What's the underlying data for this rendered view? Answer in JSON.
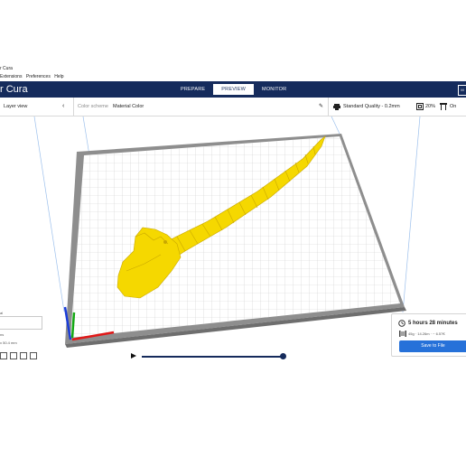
{
  "window": {
    "title": "r Cura"
  },
  "menu": {
    "items": [
      " Extensions",
      "Preferences",
      "Help"
    ]
  },
  "header": {
    "brand": "r Cura",
    "tabs": [
      {
        "label": "PREPARE",
        "active": false
      },
      {
        "label": "PREVIEW",
        "active": true
      },
      {
        "label": "MONITOR",
        "active": false
      }
    ],
    "right_button": "M"
  },
  "stage_bar": {
    "view_mode": "Layer view",
    "color_scheme_label": "Color scheme",
    "color_scheme_value": "Material Color",
    "quality": "Standard Quality - 0.2mm",
    "infill": "20%",
    "support": "On"
  },
  "left_panel": {
    "label_top": "al",
    "label_a": "ns",
    "label_b": "x 50.4 mm"
  },
  "print_info": {
    "time": "5 hours 28 minutes",
    "material": "45g · 14.26m · ~ 6.57€",
    "save_label": "Save to File"
  },
  "colors": {
    "header_bg": "#152b5c",
    "model": "#f5d800",
    "accent": "#2671d9",
    "axis_x": "#e01818",
    "axis_y": "#1a3cd8",
    "axis_z": "#14a814"
  }
}
